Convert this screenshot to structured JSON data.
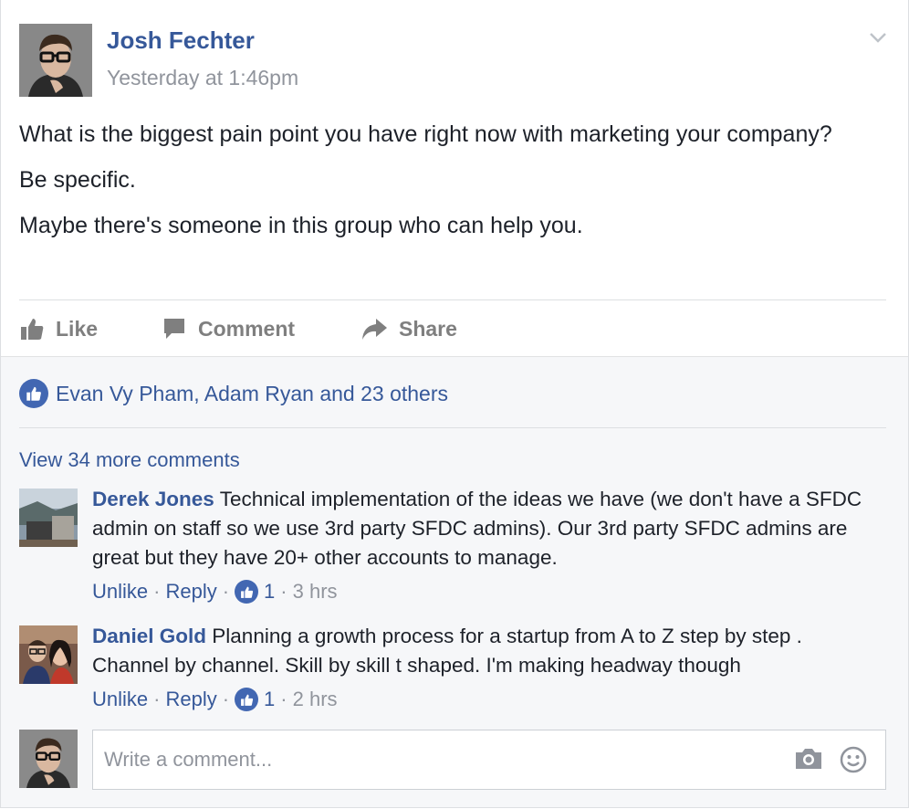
{
  "post": {
    "author": "Josh Fechter",
    "timestamp": "Yesterday at 1:46pm",
    "body": [
      "What is the biggest pain point you have right now with marketing your company?",
      "Be specific.",
      "Maybe there's someone in this group who can help you."
    ]
  },
  "actions": {
    "like": "Like",
    "comment": "Comment",
    "share": "Share"
  },
  "likes_summary": "Evan Vy Pham, Adam Ryan and 23 others",
  "view_more": "View 34 more comments",
  "comments": [
    {
      "name": "Derek Jones",
      "text": "Technical implementation of the ideas we have (we don't have a SFDC admin on staff so we use 3rd party SFDC admins). Our 3rd party SFDC admins are great but they have 20+ other accounts to manage.",
      "unlike": "Unlike",
      "reply": "Reply",
      "likes": "1",
      "time": "3 hrs"
    },
    {
      "name": "Daniel Gold",
      "text": "Planning a growth process for a startup from A to Z step by step . Channel by channel. Skill by skill t shaped. I'm making headway though",
      "unlike": "Unlike",
      "reply": "Reply",
      "likes": "1",
      "time": "2 hrs"
    }
  ],
  "write_comment": {
    "placeholder": "Write a comment..."
  },
  "icons": [
    "chevron-down-icon",
    "thumbs-up-icon",
    "comment-icon",
    "share-icon",
    "camera-icon",
    "smiley-icon"
  ],
  "colors": {
    "link": "#365899",
    "muted": "#90949c",
    "text": "#1d2129",
    "like_blue": "#4267b2",
    "feedback_bg": "#f6f7f9"
  }
}
